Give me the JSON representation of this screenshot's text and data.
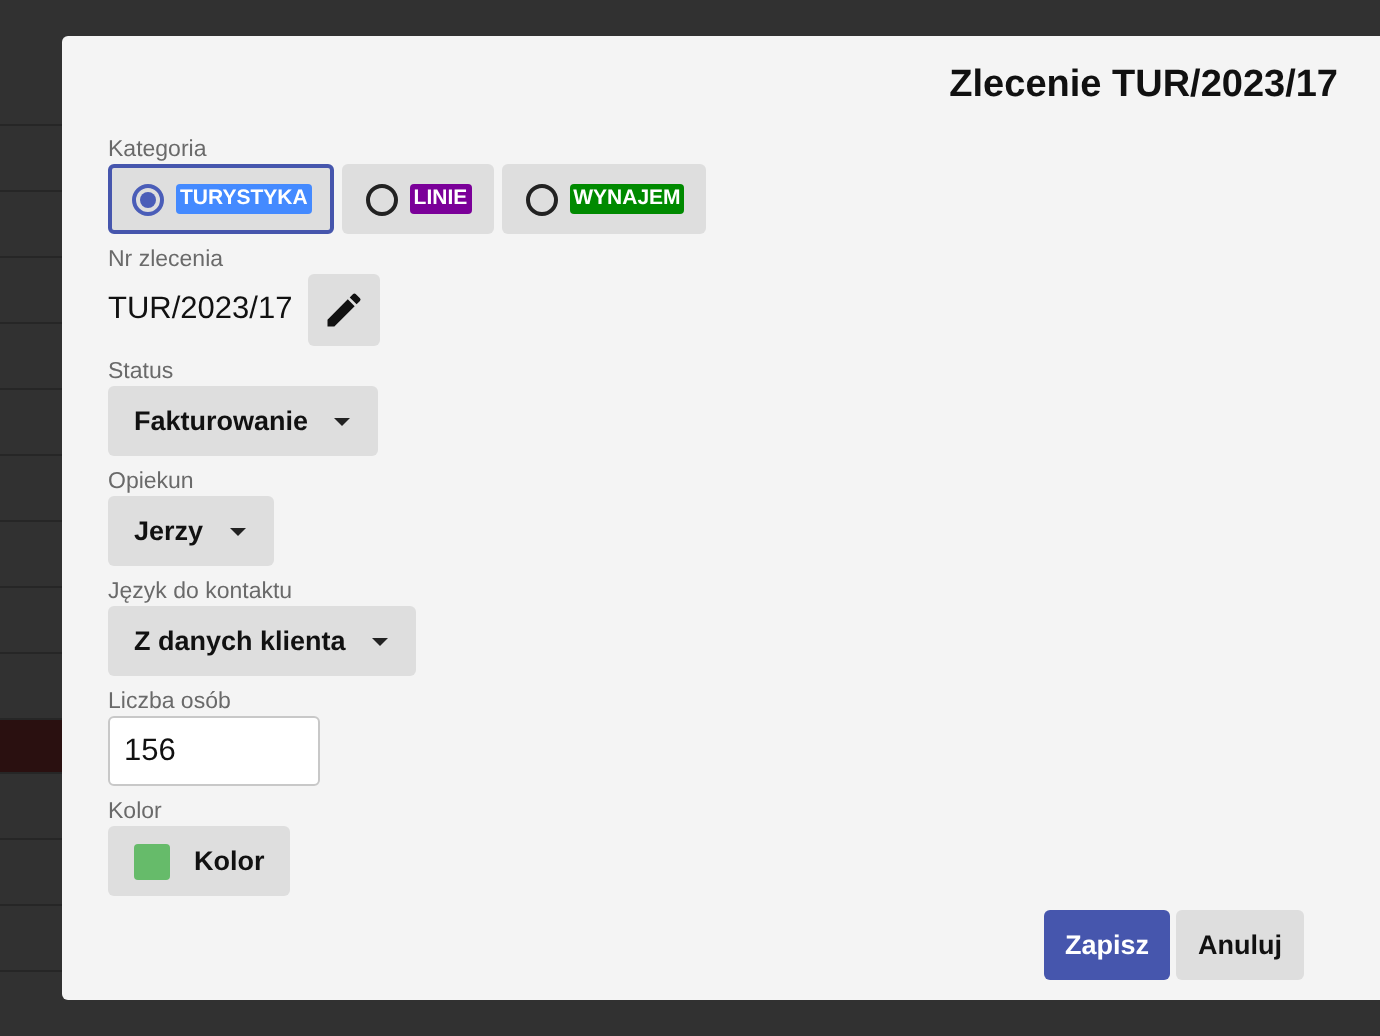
{
  "dialog": {
    "title": "Zlecenie TUR/2023/17",
    "category": {
      "label": "Kategoria",
      "options": [
        {
          "label": "TURYSTYKA",
          "color": "#448aff",
          "selected": true
        },
        {
          "label": "LINIE",
          "color": "#7b0099",
          "selected": false
        },
        {
          "label": "WYNAJEM",
          "color": "#008a00",
          "selected": false
        }
      ]
    },
    "fields": [
      {
        "kind": "text-edit",
        "label": "Nr zlecenia",
        "value": "TUR/2023/17"
      },
      {
        "kind": "select",
        "label": "Status",
        "value": "Fakturowanie"
      },
      {
        "kind": "select",
        "label": "Opiekun",
        "value": "Jerzy"
      },
      {
        "kind": "select",
        "label": "Język do kontaktu",
        "value": "Z danych klienta"
      },
      {
        "kind": "number",
        "label": "Liczba osób",
        "value": "156"
      },
      {
        "kind": "color",
        "label": "Kolor",
        "value": "Kolor",
        "color": "#66bb6a"
      }
    ],
    "buttons": [
      {
        "label": "Zapisz",
        "kind": "primary"
      },
      {
        "label": "Anuluj",
        "kind": "secondary"
      }
    ]
  }
}
